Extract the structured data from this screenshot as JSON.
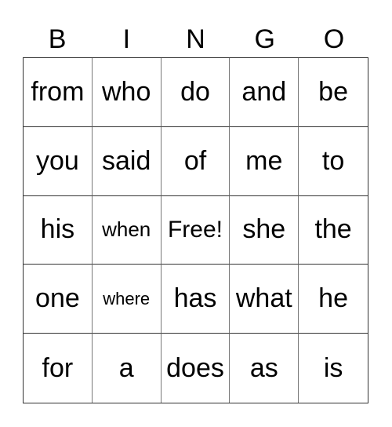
{
  "header": [
    "B",
    "I",
    "N",
    "G",
    "O"
  ],
  "rows": [
    [
      "from",
      "who",
      "do",
      "and",
      "be"
    ],
    [
      "you",
      "said",
      "of",
      "me",
      "to"
    ],
    [
      "his",
      "when",
      "Free!",
      "she",
      "the"
    ],
    [
      "one",
      "where",
      "has",
      "what",
      "he"
    ],
    [
      "for",
      "a",
      "does",
      "as",
      "is"
    ]
  ]
}
